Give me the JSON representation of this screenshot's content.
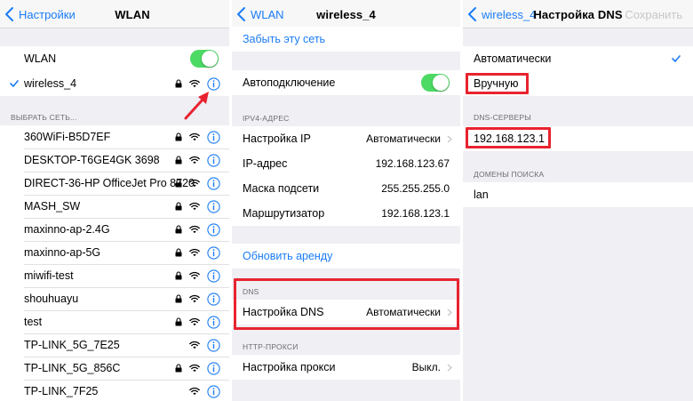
{
  "colors": {
    "accent": "#1a7cf5",
    "toggle_on": "#4cd964",
    "highlight": "#e8232f",
    "group_bg": "#efeff4"
  },
  "panel1": {
    "back_label": "Настройки",
    "title": "WLAN",
    "wlan_label": "WLAN",
    "wlan_on": true,
    "connected_network": "wireless_4",
    "section_header": "ВЫБРАТЬ СЕТЬ...",
    "networks": [
      {
        "name": "360WiFi-B5D7EF",
        "locked": true
      },
      {
        "name": "DESKTOP-T6GE4GK 3698",
        "locked": true
      },
      {
        "name": "DIRECT-36-HP OfficeJet Pro 8720",
        "locked": true
      },
      {
        "name": "MASH_SW",
        "locked": true
      },
      {
        "name": "maxinno-ap-2.4G",
        "locked": true
      },
      {
        "name": "maxinno-ap-5G",
        "locked": true
      },
      {
        "name": "miwifi-test",
        "locked": true
      },
      {
        "name": "shouhuayu",
        "locked": true
      },
      {
        "name": "test",
        "locked": true
      },
      {
        "name": "TP-LINK_5G_7E25",
        "locked": false
      },
      {
        "name": "TP-LINK_5G_856C",
        "locked": true
      },
      {
        "name": "TP-LINK_7F25",
        "locked": false
      }
    ]
  },
  "panel2": {
    "back_label": "WLAN",
    "title": "wireless_4",
    "forget_label": "Забыть эту сеть",
    "autojoin_label": "Автоподключение",
    "autojoin_on": true,
    "ipv4_header": "IPV4-АДРЕС",
    "configure_ip_label": "Настройка IP",
    "configure_ip_value": "Автоматически",
    "ip_label": "IP-адрес",
    "ip_value": "192.168.123.67",
    "mask_label": "Маска подсети",
    "mask_value": "255.255.255.0",
    "router_label": "Маршрутизатор",
    "router_value": "192.168.123.1",
    "renew_label": "Обновить аренду",
    "dns_header": "DNS",
    "dns_label": "Настройка DNS",
    "dns_value": "Автоматически",
    "proxy_header": "HTTP-ПРОКСИ",
    "proxy_label": "Настройка прокси",
    "proxy_value": "Выкл."
  },
  "panel3": {
    "back_label": "wireless_4",
    "title": "Настройка DNS",
    "save_label": "Сохранить",
    "automatic_label": "Автоматически",
    "manual_label": "Вручную",
    "dns_servers_header": "DNS-СЕРВЕРЫ",
    "dns_server_value": "192.168.123.1",
    "search_domains_header": "ДОМЕНЫ ПОИСКА",
    "search_domain_value": "lan"
  }
}
